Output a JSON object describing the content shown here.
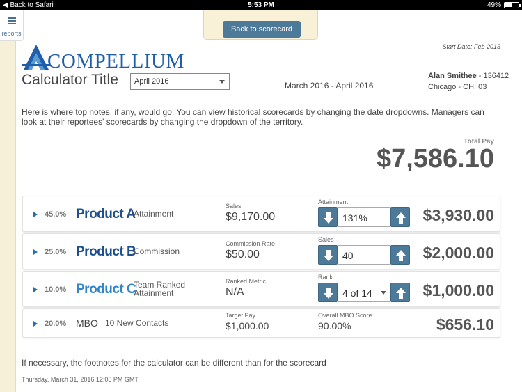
{
  "status_bar": {
    "back_label": "Back to Safari",
    "time": "5:53 PM",
    "battery": "49%",
    "battery_level": 0.49
  },
  "menu": {
    "label": "reports",
    "icon": "hamburger-icon"
  },
  "header": {
    "back_button": "Back to scorecard",
    "logo_text": "Compellium",
    "start_date": "Start Date: Feb 2013"
  },
  "calculator": {
    "title": "Calculator Title",
    "month_selected": "April 2016",
    "date_range": "March 2016 - April 2016"
  },
  "person": {
    "name": "Alan Smithee",
    "id": "- 136412",
    "location": "Chicago - CHI 03"
  },
  "notes": "Here is where top notes, if any, would go. You can view historical scorecards by changing the date dropdowns. Managers can look at their reportees' scorecards by changing the dropdown of the territory.",
  "total": {
    "label": "Total Pay",
    "value": "$7,586.10"
  },
  "rows": [
    {
      "pct": "45.0%",
      "name": "Product A",
      "type": "Attainment",
      "metric_label": "Sales",
      "metric_value": "$9,170.00",
      "stepper_label": "Attainment",
      "stepper_value": "131%",
      "amount": "$3,930.00"
    },
    {
      "pct": "25.0%",
      "name": "Product B",
      "type": "Commission",
      "metric_label": "Commission Rate",
      "metric_value": "$50.00",
      "stepper_label": "Sales",
      "stepper_value": "40",
      "amount": "$2,000.00"
    },
    {
      "pct": "10.0%",
      "name": "Product C",
      "type": "Team Ranked Attainment",
      "metric_label": "Ranked Metric",
      "metric_value": "N/A",
      "stepper_label": "Rank",
      "stepper_value": "4 of 14",
      "amount": "$1,000.00"
    },
    {
      "pct": "20.0%",
      "name": "MBO",
      "type": "10 New Contacts",
      "metric_label": "Target Pay",
      "metric_value": "$1,000.00",
      "stepper_label": "Overall MBO Score",
      "stepper_value": "90.00%",
      "amount": "$656.10"
    }
  ],
  "footnote": "If necessary, the footnotes for the calculator can be different than for the scorecard",
  "timestamp": "Thursday, March 31, 2016 12:05 PM GMT",
  "colors": {
    "accent": "#4e7a9a",
    "brand": "#1f5ea8",
    "background": "#f6f0d8"
  }
}
